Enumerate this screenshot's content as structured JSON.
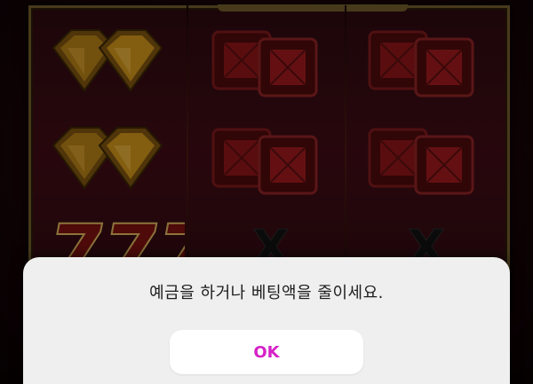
{
  "game": {
    "reels": [
      [
        "yellow-gem-pair",
        "yellow-gem-pair",
        "triple-seven"
      ],
      [
        "red-square-gem-pair",
        "red-square-gem-pair",
        "x-symbol"
      ],
      [
        "red-square-gem-pair",
        "red-square-gem-pair",
        "x-symbol"
      ]
    ],
    "seven_text": "777",
    "x_text": "X"
  },
  "dialog": {
    "message": "예금을 하거나 베팅액을 줄이세요.",
    "ok_label": "OK"
  },
  "colors": {
    "accent": "#d621c8",
    "dialog_bg": "#efefef",
    "frame_gold": "#6d5a2a",
    "gem_yellow": "#c9901a",
    "gem_red": "#8a1518"
  }
}
